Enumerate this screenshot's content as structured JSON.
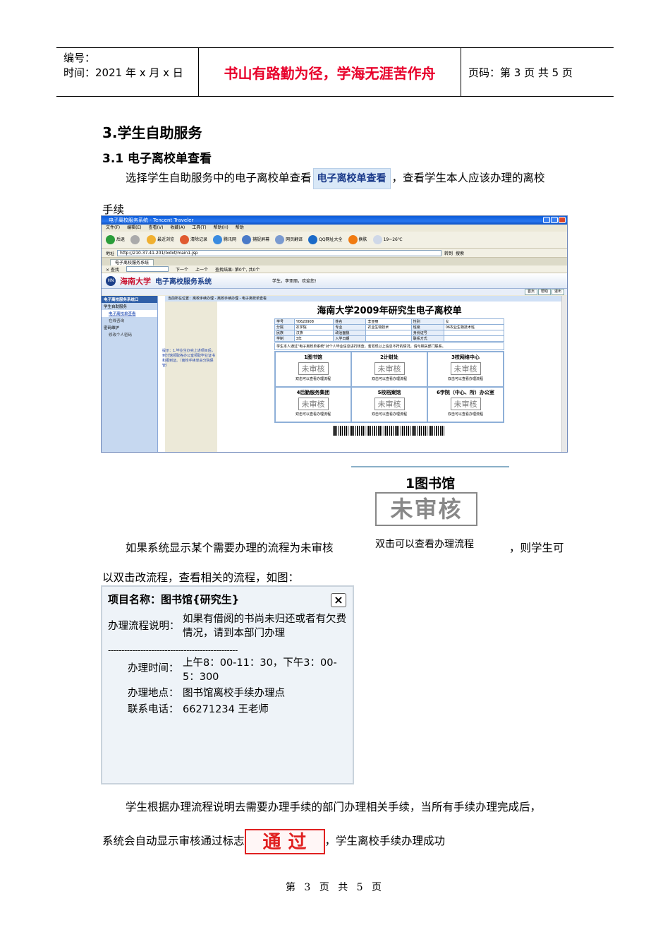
{
  "header": {
    "number_label": "编号：",
    "time_label": "时间：2021 年 x 月 x 日",
    "motto": "书山有路勤为径，学海无涯苦作舟",
    "page_info": "页码：第 3 页  共 5 页"
  },
  "section": {
    "title": "3.学生自助服务",
    "subtitle": "3.1 电子离校单查看",
    "para1_before": "选择学生自助服务中的电子离校单查看",
    "para1_chip": "电子离校单查看",
    "para1_after": "，查看学生本人应该办理的离校",
    "para1_line2": "手续"
  },
  "browser": {
    "window_title": "电子离校服务系统 - Tencent Traveler",
    "menu": [
      "文件(F)",
      "编辑(E)",
      "查看(V)",
      "收藏(A)",
      "工具(T)",
      "帮助(H)",
      "帮助"
    ],
    "toolbar": [
      "后退",
      "前进",
      "最近浏览",
      "清除记录",
      "腾讯网",
      "捕捉屏幕",
      "网页翻译",
      "QQ网址大全",
      "换肤",
      "19~26℃"
    ],
    "address_label": "地址",
    "address": "http://210.37.41.201/lxdxt/main1.jsp",
    "go": "转到",
    "search": "搜索",
    "tab": "电子离校服务系统",
    "find_close": "× 查找",
    "find_next": "下一个",
    "find_prev": "上一个",
    "find_result": "查找结果: 第0个, 共0个",
    "school": "海南大学",
    "system": "电子离校服务系统",
    "welcome": "学生，李亚丽，欢迎您!",
    "top_links": [
      "首页",
      "帮助",
      "退出"
    ],
    "side_header": "电子离校服务系统口",
    "side_items": [
      {
        "label": "学生自助服务",
        "subs": [
          "电子离校单查看",
          "在线咨询"
        ]
      },
      {
        "label": "密码维护",
        "subs": [
          "修改个人密码"
        ]
      }
    ],
    "crumb": "当前所在位置：离校手续办理 - 离校手续办理 - 电子离校单查看",
    "content_title": "海南大学2009年研究生电子离校单",
    "tip": "提示：1.毕业生办完上述项目后，到分馆领取各办公室领取毕业证书和报到证。（离校手续单由分院保管）",
    "info_rows": [
      [
        "学号",
        "Y0620908",
        "姓名",
        "李亚丽",
        "性别",
        "女"
      ],
      [
        "分院",
        "农学院",
        "专业",
        "农业生物技术",
        "班级",
        "06农业生物技术班"
      ],
      [
        "民族",
        "汉族",
        "政治面貌",
        "",
        "身份证号",
        ""
      ],
      [
        "学制",
        "3年",
        "入学日期",
        "",
        "联系方式",
        ""
      ]
    ],
    "note": "学生本人通过\"电子离校单系统\"对个人毕业信息进行核查，若发现以上信息不符的情况，请与相关部门联系。",
    "units": [
      {
        "name": "1图书馆",
        "status": "未审核",
        "link": "双击可以查看办理流程"
      },
      {
        "name": "2计财处",
        "status": "未审核",
        "link": "双击可以查看办理流程"
      },
      {
        "name": "3校网络中心",
        "status": "未审核",
        "link": "双击可以查看办理流程"
      },
      {
        "name": "4后勤服务集团",
        "status": "未审核",
        "link": "双击可以查看办理流程"
      },
      {
        "name": "5校档案馆",
        "status": "未审核",
        "link": "双击可以查看办理流程"
      },
      {
        "name": "6学院（中心、所）办公室",
        "status": "未审核",
        "link": "双击可以查看办理流程"
      }
    ]
  },
  "lib_figure": {
    "name": "1图书馆",
    "status": "未审核",
    "link": "双击可以查看办理流程"
  },
  "para2": {
    "before": "如果系统显示某个需要办理的流程为未审核",
    "after": "，则学生可",
    "line2": "以双击改流程，查看相关的流程，如图："
  },
  "dialog": {
    "title": "项目名称：图书馆{研究生}",
    "close": "×",
    "desc_label": "办理流程说明：",
    "desc_line1": "如果有借阅的书尚未归还或者有欠费",
    "desc_line2": "情况，请到本部门办理",
    "divider": "------------------------------------------------",
    "time_label": "办理时间：",
    "time_line1": "上午8：00-11：30，下午3：00-",
    "time_line2": "5：300",
    "place_label": "办理地点：",
    "place": "图书馆离校手续办理点",
    "phone_label": "联系电话：",
    "phone": "66271234 王老师"
  },
  "para3": {
    "line1": "学生根据办理流程说明去需要办理手续的部门办理相关手续，当所有手续办理完成后，",
    "before": "系统会自动显示审核通过标志",
    "stamp": "通过",
    "after": "，学生离校手续办理成功"
  },
  "footer": "第 3 页 共 5 页"
}
